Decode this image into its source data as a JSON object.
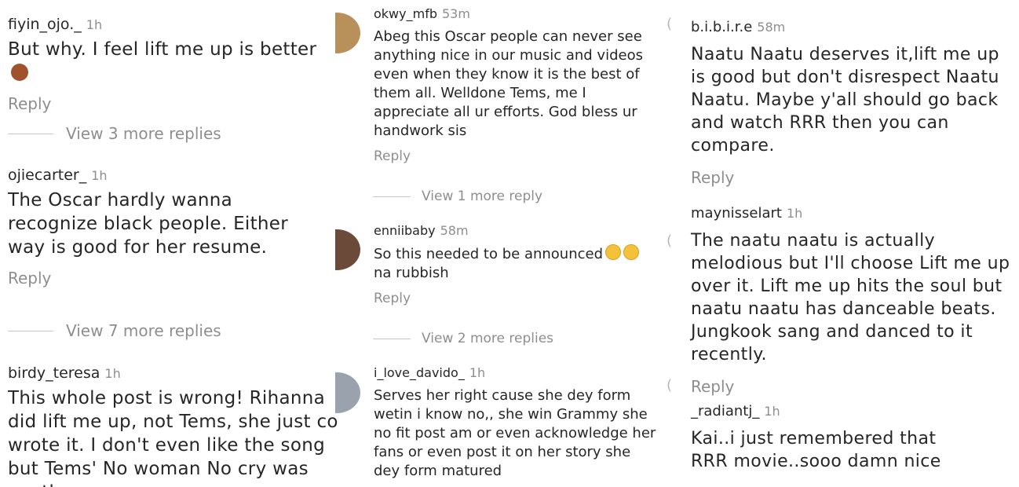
{
  "columns": {
    "left": {
      "comments": [
        {
          "username": "fiyin_ojo._",
          "time": "1h",
          "text": "But why. I feel lift me up is better",
          "emoji": "person-gesturing-icon",
          "reply": "Reply",
          "view_more": "View 3 more replies"
        },
        {
          "username": "ojiecarter_",
          "time": "1h",
          "text": "The Oscar hardly wanna recognize black people. Either way is good for her resume.",
          "reply": "Reply",
          "view_more": "View 7 more replies"
        },
        {
          "username": "birdy_teresa",
          "time": "1h",
          "text": "This whole post is wrong! Rihanna did lift me up, not Tems, she just co wrote it. I don't even like the song but Tems' No woman No cry was worthy"
        }
      ]
    },
    "middle": {
      "comments": [
        {
          "username": "okwy_mfb",
          "time": "53m",
          "text": "Abeg this Oscar people can never see anything nice in our music and videos even when they know it is the best of them all. Welldone Tems, me I appreciate all ur efforts.  God bless ur handwork sis",
          "reply": "Reply",
          "view_more": "View 1 more reply",
          "avatar_color": "#b8915a"
        },
        {
          "username": "enniibaby",
          "time": "58m",
          "text": "So this needed to be announced",
          "text2": "na rubbish",
          "emoji": "tired-face-icon",
          "reply": "Reply",
          "view_more": "View 2 more replies",
          "avatar_color": "#6b4a3a"
        },
        {
          "username": "i_love_davido_",
          "time": "1h",
          "text": "Serves her right cause she dey form wetin i know no,, she win Grammy she no fit post am or even acknowledge her fans or even post it on her story she dey form matured",
          "avatar_color": "#9aa3ad"
        }
      ]
    },
    "right": {
      "comments": [
        {
          "username": "b.i.b.i.r.e",
          "time": "58m",
          "text": "Naatu Naatu deserves it,lift me up is good but don't disrespect Naatu Naatu. Maybe y'all should go back and watch RRR then you can compare.",
          "reply": "Reply"
        },
        {
          "username": "maynisselart",
          "time": "1h",
          "text": "The naatu naatu is actually melodious but I'll choose Lift me up over it. Lift me up hits the soul but naatu naatu has danceable beats. Jungkook sang and danced to it recently.",
          "reply": "Reply"
        },
        {
          "username": "_radiantj_",
          "time": "1h",
          "text": "Kai..i just remembered that RRR movie..sooo damn nice"
        }
      ]
    }
  }
}
